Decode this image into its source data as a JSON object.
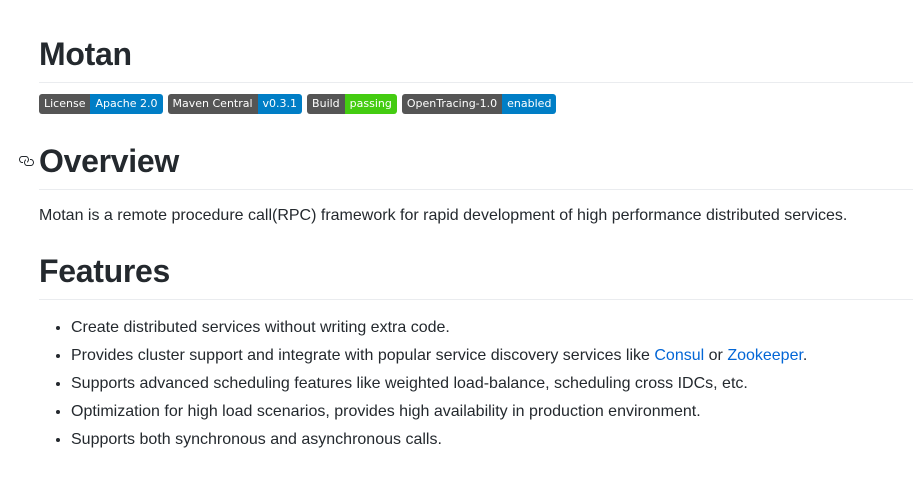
{
  "title": "Motan",
  "badges": [
    {
      "label": "License",
      "value": "Apache 2.0",
      "color": "#007ec6"
    },
    {
      "label": "Maven Central",
      "value": "v0.3.1",
      "color": "#007ec6"
    },
    {
      "label": "Build",
      "value": "passing",
      "color": "#44cc11"
    },
    {
      "label": "OpenTracing-1.0",
      "value": "enabled",
      "color": "#007ec6"
    }
  ],
  "overview": {
    "heading": "Overview",
    "anchor_icon": "link-icon",
    "text": "Motan is a remote procedure call(RPC) framework for rapid development of high performance distributed services."
  },
  "features": {
    "heading": "Features",
    "items": [
      "Create distributed services without writing extra code.",
      {
        "before": "Provides cluster support and integrate with popular service discovery services like ",
        "link1": "Consul",
        "middle": " or ",
        "link2": "Zookeeper",
        "after": "."
      },
      "Supports advanced scheduling features like weighted load-balance, scheduling cross IDCs, etc.",
      "Optimization for high load scenarios, provides high availability in production environment.",
      "Supports both synchronous and asynchronous calls."
    ]
  },
  "colors": {
    "text": "#24292e",
    "link": "#0366d6",
    "badge_label_bg": "#555555",
    "rule": "#eaecef"
  }
}
